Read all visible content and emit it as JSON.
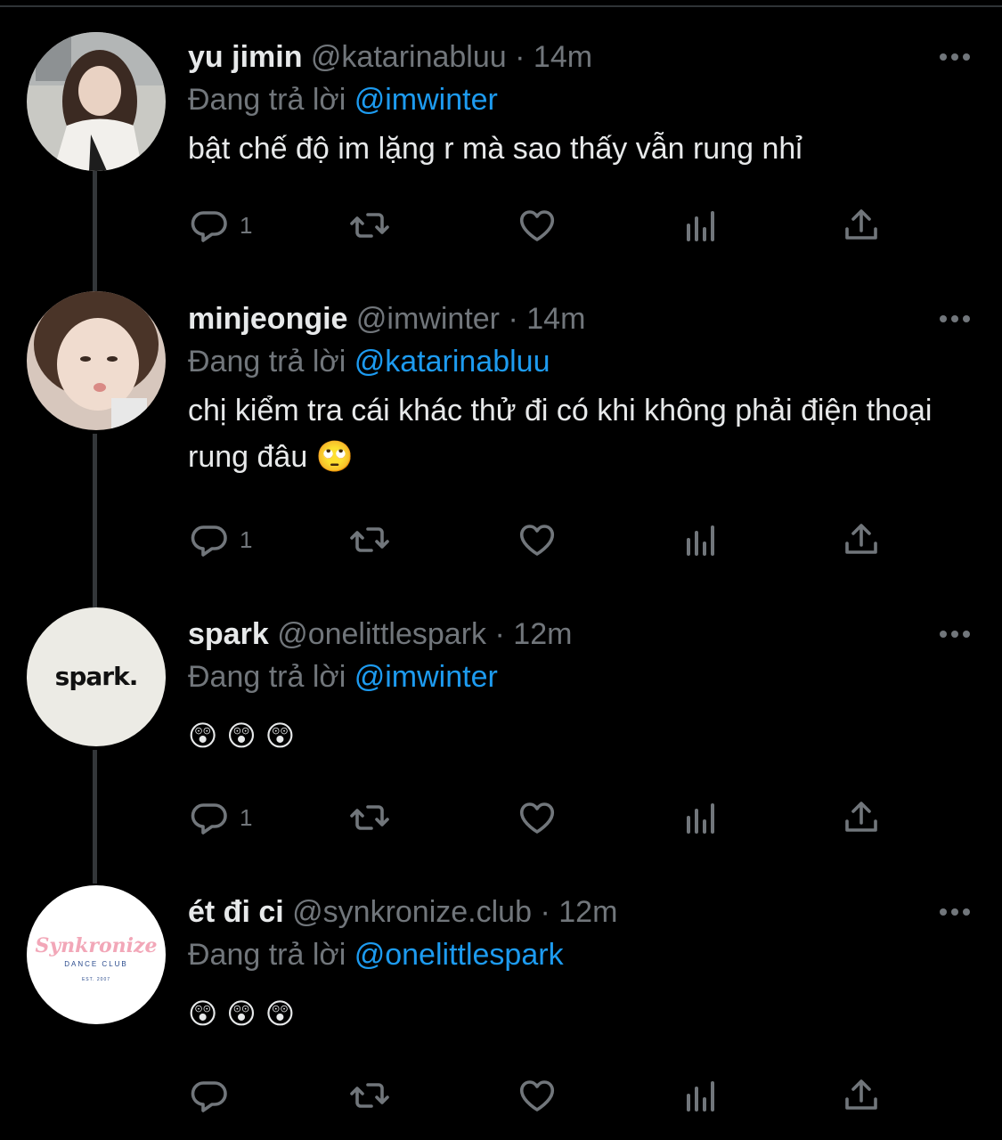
{
  "replying_label": "Đang trả lời",
  "colors": {
    "background": "#000000",
    "text": "#e7e9ea",
    "muted": "#71767b",
    "mention": "#1d9bf0",
    "thread_line": "#333639"
  },
  "tweets": [
    {
      "name": "yu jimin",
      "handle": "@katarinabluu",
      "dot": "·",
      "time": "14m",
      "replying_to": "@imwinter",
      "text": "bật chế độ im lặng r mà sao thấy vẫn rung nhỉ",
      "reply_count": "1",
      "avatar": "photo-avatar"
    },
    {
      "name": "minjeongie",
      "handle": "@imwinter",
      "dot": "·",
      "time": "14m",
      "replying_to": "@katarinabluu",
      "text": "chị kiểm tra cái khác thử đi có khi không phải điện thoại rung đâu 🙄",
      "reply_count": "1",
      "avatar": "photo-avatar"
    },
    {
      "name": "spark",
      "handle": "@onelittlespark",
      "dot": "·",
      "time": "12m",
      "replying_to": "@imwinter",
      "emojis": [
        "😲",
        "😲",
        "😲"
      ],
      "reply_count": "1",
      "avatar_logo_text": "spark."
    },
    {
      "name": "ét đi ci",
      "handle": "@synkronize.club",
      "dot": "·",
      "time": "12m",
      "replying_to": "@onelittlespark",
      "emojis": [
        "😲",
        "😲",
        "😲"
      ],
      "reply_count": "",
      "avatar_logo_text": "Synkronize",
      "avatar_logo_subtext": "DANCE CLUB",
      "avatar_logo_est": "EST. 2007"
    }
  ],
  "icons": {
    "reply": "reply-icon",
    "retweet": "retweet-icon",
    "like": "heart-icon",
    "views": "views-icon",
    "share": "share-icon",
    "more": "more-icon"
  }
}
